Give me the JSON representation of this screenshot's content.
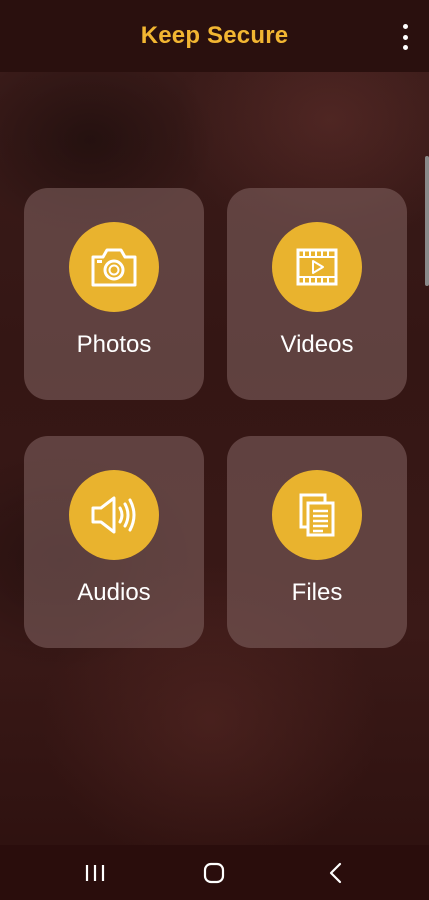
{
  "app": {
    "title": "Keep Secure"
  },
  "colors": {
    "accent": "#f2b632",
    "icon_circle": "#e9b32e",
    "tile_background": "#7a5c5a",
    "appbar_background": "#2a100e"
  },
  "appbar": {
    "menu_icon": "more-vertical-icon"
  },
  "tiles": [
    {
      "label": "Photos",
      "icon": "camera-icon"
    },
    {
      "label": "Videos",
      "icon": "film-play-icon"
    },
    {
      "label": "Audios",
      "icon": "speaker-icon"
    },
    {
      "label": "Files",
      "icon": "documents-icon"
    }
  ],
  "navbar": {
    "recents_icon": "recents-icon",
    "home_icon": "home-icon",
    "back_icon": "back-icon"
  }
}
